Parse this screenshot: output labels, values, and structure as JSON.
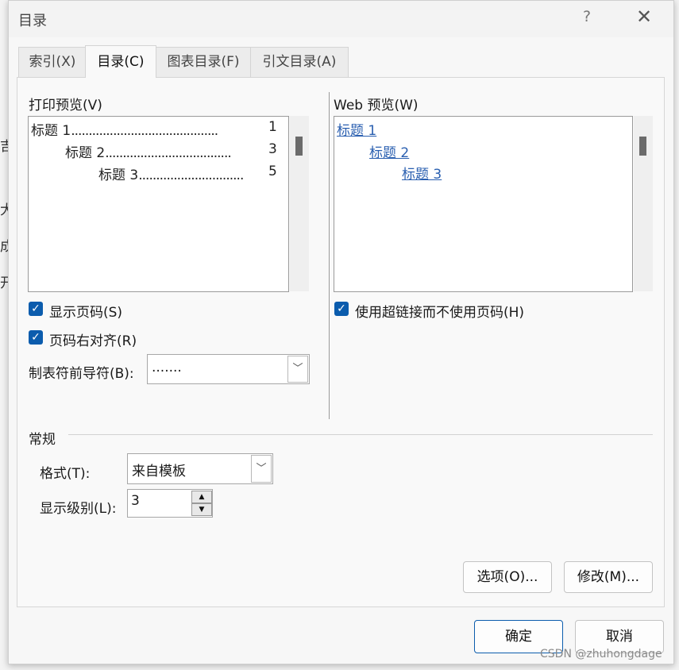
{
  "dialog": {
    "title": "目录",
    "help_glyph": "?",
    "close_glyph": "✕"
  },
  "tabs": [
    {
      "label": "索引(X)"
    },
    {
      "label": "目录(C)"
    },
    {
      "label": "图表目录(F)"
    },
    {
      "label": "引文目录(A)"
    }
  ],
  "print_preview": {
    "label": "打印预览(V)",
    "rows": [
      {
        "heading": "标题 1",
        "dots": "..........................................",
        "page": "1"
      },
      {
        "heading": "标题 2",
        "dots": "....................................",
        "page": "3"
      },
      {
        "heading": "标题 3",
        "dots": "..............................",
        "page": "5"
      }
    ]
  },
  "web_preview": {
    "label": "Web 预览(W)",
    "links": [
      "标题 1",
      "标题 2",
      "标题 3"
    ]
  },
  "options": {
    "show_page_numbers": {
      "label": "显示页码(S)",
      "checked": true
    },
    "right_align": {
      "label": "页码右对齐(R)",
      "checked": true
    },
    "use_hyperlinks": {
      "label": "使用超链接而不使用页码(H)",
      "checked": true
    },
    "check_glyph": "✓",
    "tab_leader": {
      "label": "制表符前导符(B):",
      "value": "......."
    }
  },
  "general": {
    "label": "常规",
    "format": {
      "label": "格式(T):",
      "value": "来自模板"
    },
    "levels": {
      "label": "显示级别(L):",
      "value": "3"
    }
  },
  "buttons": {
    "options": "选项(O)...",
    "modify": "修改(M)...",
    "ok": "确定",
    "cancel": "取消"
  },
  "icons": {
    "dropdown": "﹀",
    "spin_up": "▲",
    "spin_down": "▼"
  },
  "background": {
    "chars": [
      "吉",
      "大",
      "成",
      "开"
    ]
  },
  "watermark": "CSDN @zhuhongdage",
  "colors": {
    "accent": "#0b5cad",
    "link": "#2a5fb0"
  }
}
